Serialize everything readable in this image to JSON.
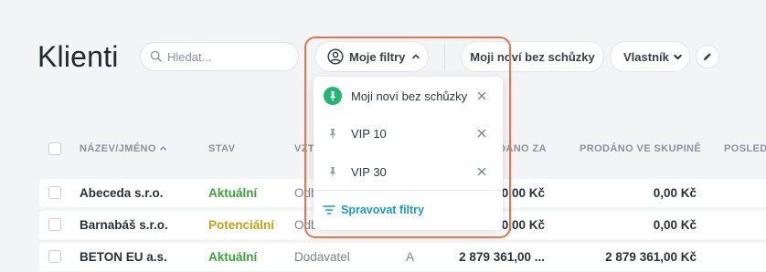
{
  "page": {
    "title": "Klienti"
  },
  "search": {
    "placeholder": "Hledat..."
  },
  "toolbar": {
    "filters_label": "Moje filtry",
    "saved_filter_label": "Moji noví bez schůzky",
    "owner_label": "Vlastník",
    "icons": {
      "filters": "user-circle-icon",
      "edit": "pencil-icon"
    }
  },
  "dropdown": {
    "items": [
      {
        "label": "Moji noví bez schůzky",
        "pinned": true
      },
      {
        "label": "VIP 10",
        "pinned": false
      },
      {
        "label": "VIP 30",
        "pinned": false
      }
    ],
    "manage_label": "Spravovat filtry"
  },
  "table": {
    "columns": [
      "NÁZEV/JMÉNO",
      "STAV",
      "VZT",
      "DANO ZA",
      "PRODÁNO VE SKUPINĚ",
      "POSLED"
    ],
    "sort_column": "NÁZEV/JMÉNO",
    "rows": [
      {
        "name": "Abeceda s.r.o.",
        "status": "Aktuální",
        "relation": "Odb",
        "category": "",
        "sold": "0,00 Kč",
        "sold_group": "0,00 Kč"
      },
      {
        "name": "Barnabáš s.r.o.",
        "status": "Potenciální",
        "relation": "Odb",
        "category": "",
        "sold": "0,00 Kč",
        "sold_group": "0,00 Kč"
      },
      {
        "name": "BETON EU a.s.",
        "status": "Aktuální",
        "relation": "Dodavatel",
        "category": "A",
        "sold": "2 879 361,00 ...",
        "sold_group": "2 879 361,00 Kč"
      }
    ]
  },
  "colors": {
    "status_current": "#3aa33a",
    "status_potential": "#c9a10e",
    "accent": "#1a9bc7",
    "highlight": "#e5744d",
    "pin_active_bg": "#22b573"
  }
}
